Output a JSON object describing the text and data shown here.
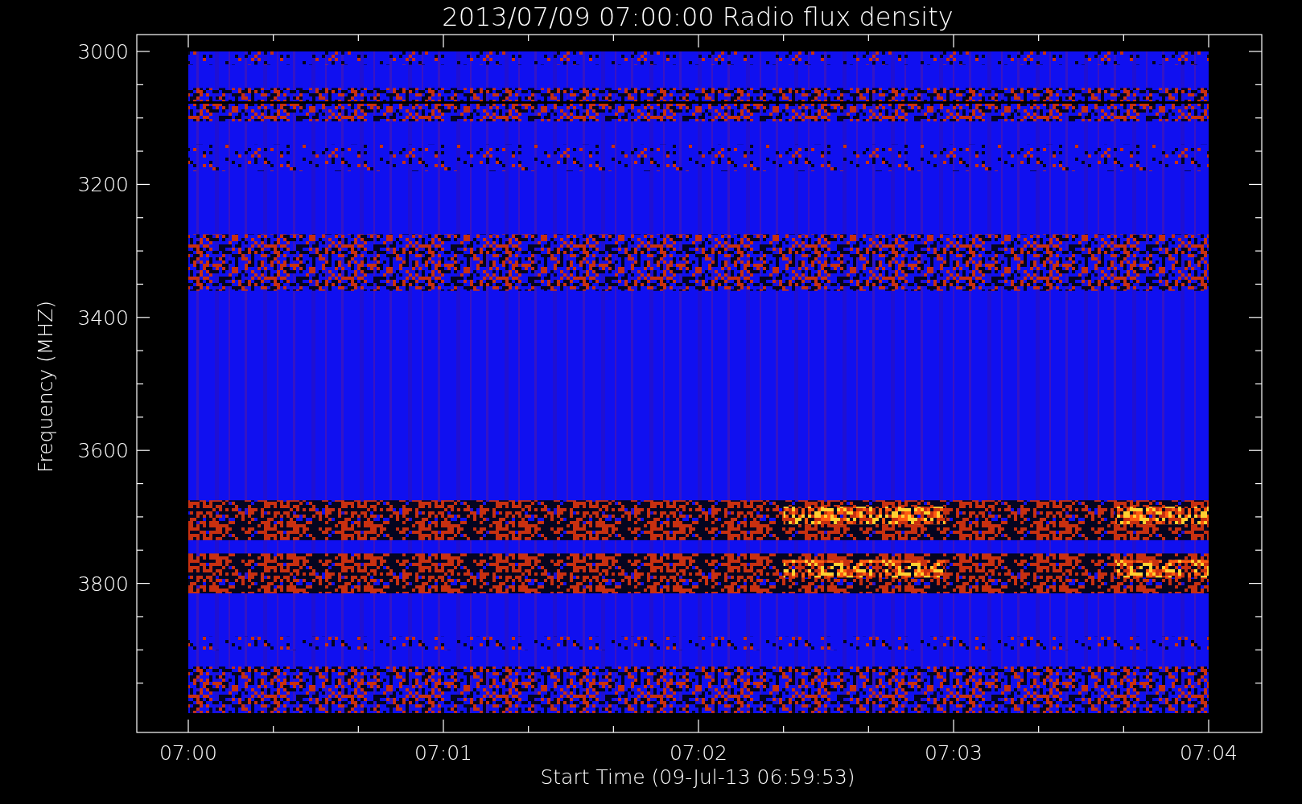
{
  "plot": {
    "title": "2013/07/09 07:00:00 Radio flux density",
    "y_axis_label": "Frequency (MHZ)",
    "x_axis_label": "Start Time (09-Jul-13 06:59:53)",
    "y_tick_labels": [
      "3000",
      "3200",
      "3400",
      "3600",
      "3800"
    ],
    "x_tick_labels": [
      "07:00",
      "07:01",
      "07:02",
      "07:03",
      "07:04"
    ]
  }
}
